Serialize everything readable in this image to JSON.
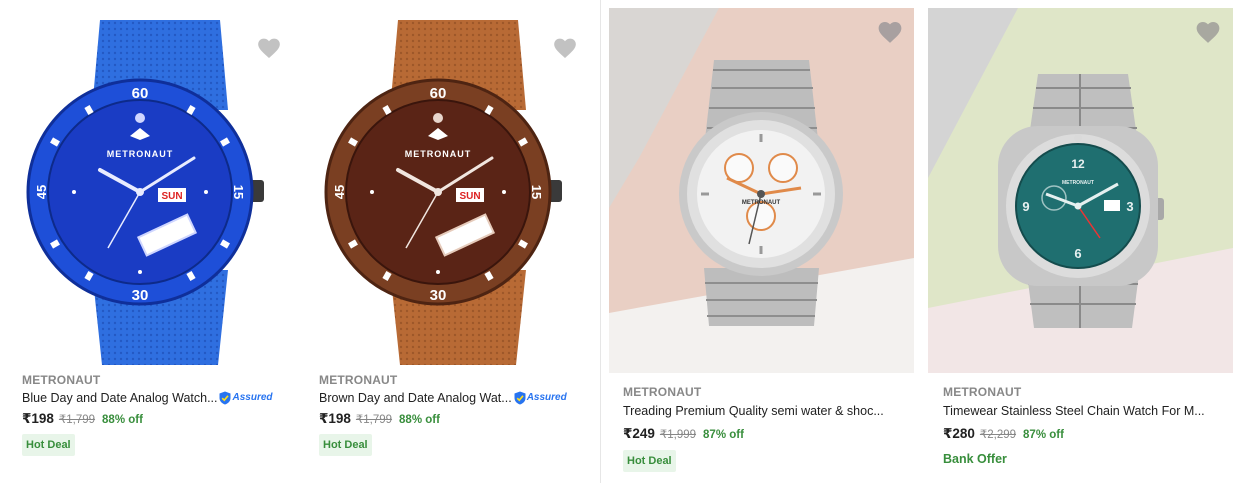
{
  "products": [
    {
      "brand": "METRONAUT",
      "title": "Blue Day and Date Analog Watch...",
      "assured": "Assured",
      "price": "₹198",
      "mrp": "₹1,799",
      "discount": "88% off",
      "tag": "Hot Deal",
      "dial_brand": "METRONAUT",
      "day_window": "SUN",
      "image_colors": {
        "strap": "#2f6fe0",
        "bezel": "#1e4fd8",
        "dial": "#1a3cc4"
      }
    },
    {
      "brand": "METRONAUT",
      "title": "Brown Day and Date Analog Wat...",
      "assured": "Assured",
      "price": "₹198",
      "mrp": "₹1,799",
      "discount": "88% off",
      "tag": "Hot Deal",
      "dial_brand": "METRONAUT",
      "day_window": "SUN",
      "image_colors": {
        "strap": "#b86a35",
        "bezel": "#7a3f22",
        "dial": "#5a2416"
      }
    },
    {
      "brand": "METRONAUT",
      "title": "Treading Premium Quality semi water & shoc...",
      "price": "₹249",
      "mrp": "₹1,999",
      "discount": "87% off",
      "tag": "Hot Deal",
      "dial_brand": "METRONAUT",
      "image_colors": {
        "background": "#e9cfc4",
        "dial": "#f2f2f2",
        "accent": "#e08a4a"
      }
    },
    {
      "brand": "METRONAUT",
      "title": "Timewear Stainless Steel Chain Watch For M...",
      "price": "₹280",
      "mrp": "₹2,299",
      "discount": "87% off",
      "offer": "Bank Offer",
      "dial_brand": "METRONAUT",
      "image_colors": {
        "background": "#dfe6c8",
        "dial": "#1f6f70"
      }
    }
  ],
  "colors": {
    "discount_green": "#388e3c",
    "tag_bg": "#e8f5e9",
    "assured_blue": "#2874f0",
    "wishlist_grey": "#c2c2c2"
  }
}
